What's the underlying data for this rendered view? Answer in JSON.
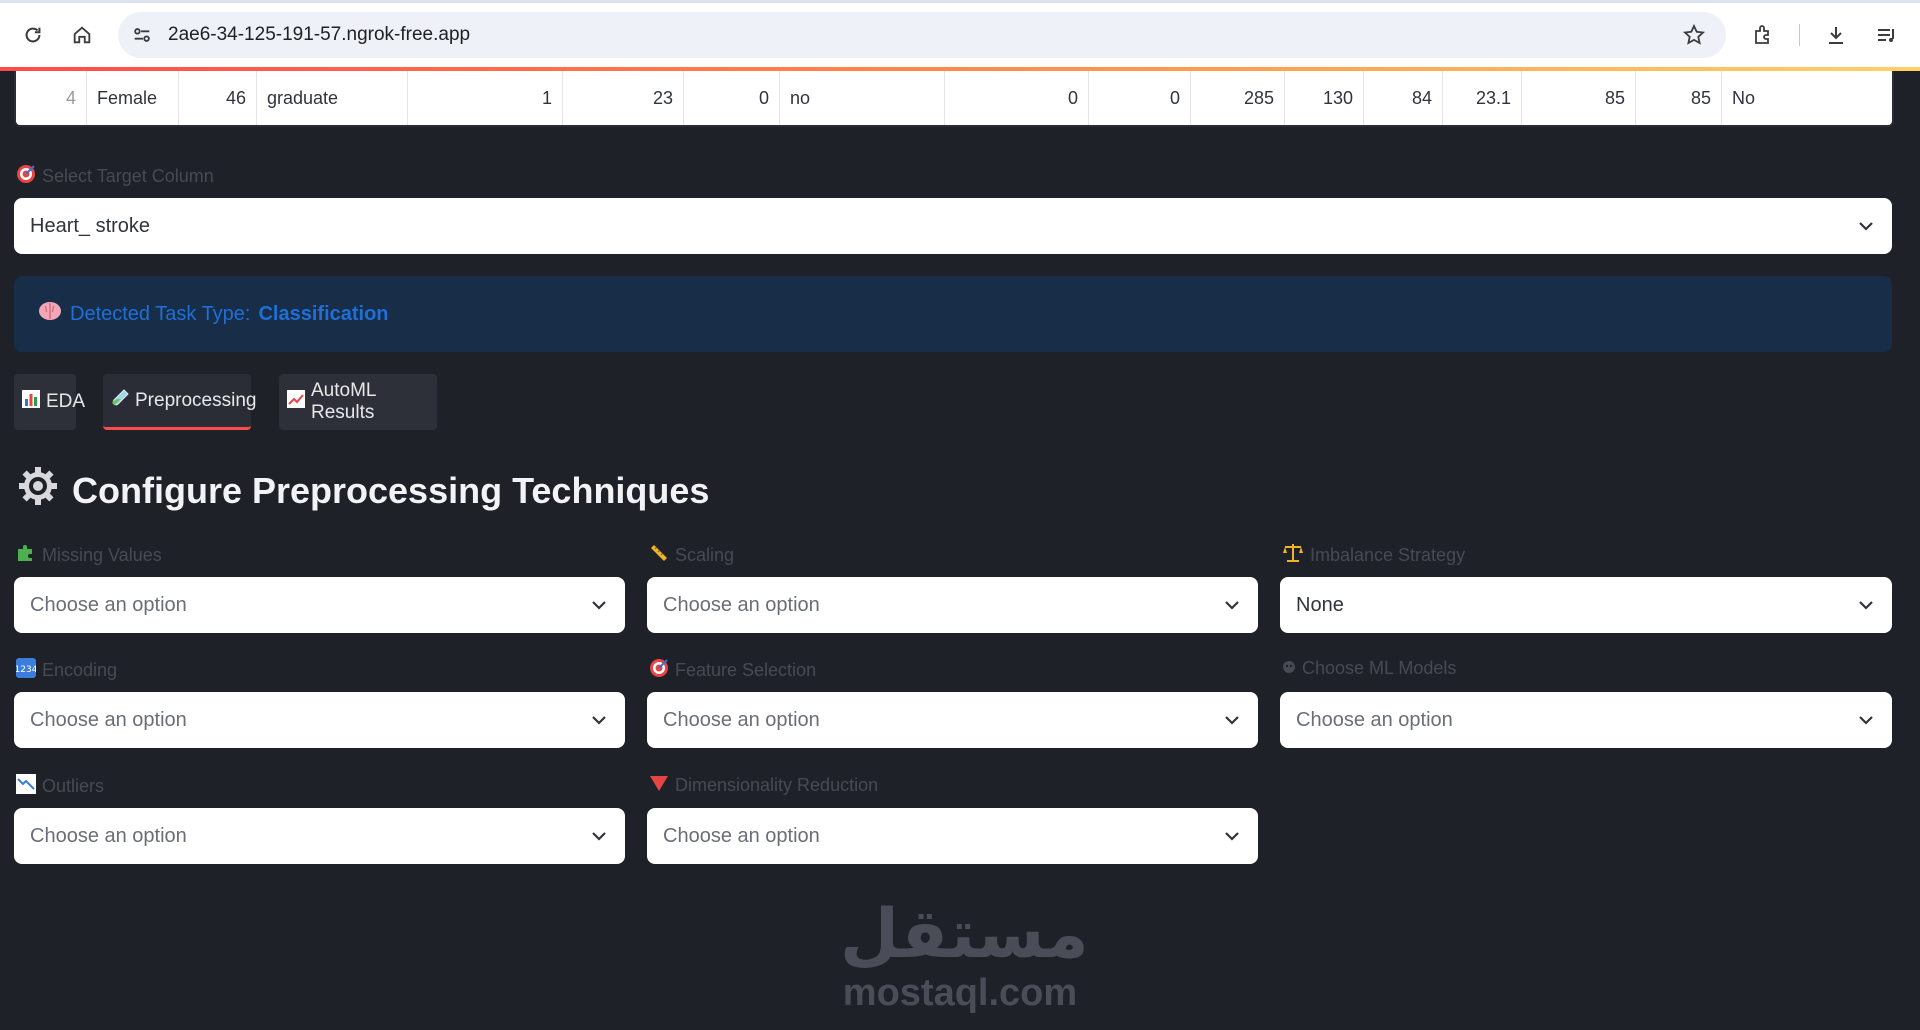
{
  "browser": {
    "url": "2ae6-34-125-191-57.ngrok-free.app"
  },
  "table": {
    "row": [
      "4",
      "Female",
      "46",
      "graduate",
      "1",
      "23",
      "0",
      "no",
      "0",
      "0",
      "285",
      "130",
      "84",
      "23.1",
      "85",
      "85",
      "No"
    ]
  },
  "target": {
    "label": "Select Target Column",
    "value": "Heart_ stroke"
  },
  "task": {
    "prefix": "Detected Task Type:",
    "type": "Classification"
  },
  "tabs": [
    {
      "label": "EDA"
    },
    {
      "label": "Preprocessing"
    },
    {
      "label": "AutoML Results"
    }
  ],
  "section": {
    "title": "Configure Preprocessing Techniques"
  },
  "fields": {
    "missing": {
      "label": "Missing Values",
      "value": "Choose an option"
    },
    "scaling": {
      "label": "Scaling",
      "value": "Choose an option"
    },
    "imbalance": {
      "label": "Imbalance Strategy",
      "value": "None"
    },
    "encoding": {
      "label": "Encoding",
      "value": "Choose an option"
    },
    "feature": {
      "label": "Feature Selection",
      "value": "Choose an option"
    },
    "models": {
      "label": "Choose ML Models",
      "value": "Choose an option"
    },
    "outliers": {
      "label": "Outliers",
      "value": "Choose an option"
    },
    "dimred": {
      "label": "Dimensionality Reduction",
      "value": "Choose an option"
    }
  },
  "watermark": {
    "arabic": "مستقل",
    "latin": "mostaql.com"
  },
  "colors": {
    "accent": "#ff4b4b",
    "info_bg": "#172d48",
    "info_text": "#1f6fd6",
    "app_bg": "#1f2128"
  },
  "icons": [
    "reload-icon",
    "home-icon",
    "site-settings-icon",
    "star-icon",
    "extensions-icon",
    "download-icon",
    "reading-list-icon",
    "target-icon",
    "brain-icon",
    "bar-chart-icon",
    "test-tube-icon",
    "chart-up-icon",
    "gear-icon",
    "puzzle-icon",
    "ruler-icon",
    "scales-icon",
    "abc-icon",
    "robot-icon",
    "chart-down-icon",
    "red-triangle-icon"
  ]
}
